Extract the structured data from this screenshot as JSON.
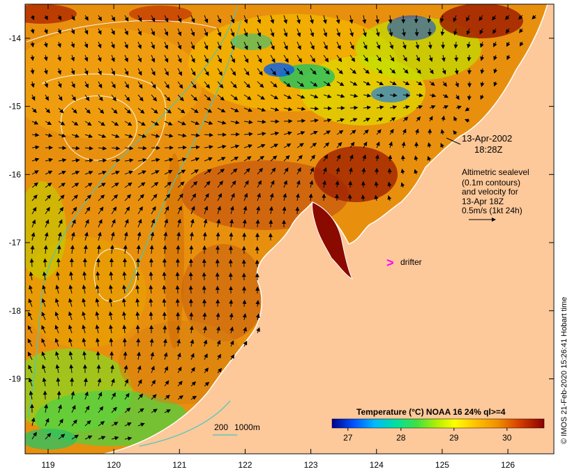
{
  "map": {
    "lon_ticks": [
      "119",
      "120",
      "121",
      "122",
      "123",
      "124",
      "125",
      "126"
    ],
    "lat_ticks": [
      "-14",
      "-15",
      "-16",
      "-17",
      "-18",
      "-19"
    ],
    "lon_range": [
      118.65,
      126.7
    ],
    "lat_range": [
      -13.5,
      -20.1
    ]
  },
  "annotations": {
    "date": "13-Apr-2002",
    "time": "18:28Z",
    "altimetry_lines": [
      "Altimetric sealevel",
      "(0.1m contours)",
      "and velocity for",
      "13-Apr 18Z",
      "0.5m/s (1kt 24h)"
    ],
    "drifter_label": "drifter",
    "drifter_color": "#ff00ff"
  },
  "isobath": {
    "label_200": "200",
    "label_1000": "1000m",
    "color": "#40c8c0"
  },
  "legend": {
    "title": "Temperature (°C) NOAA 16 24% ql>=4",
    "ticks": [
      "27",
      "28",
      "29",
      "30"
    ],
    "range": [
      26.7,
      30.7
    ],
    "colors": [
      "#00008b",
      "#0060ff",
      "#00c0ff",
      "#00e0a0",
      "#40e040",
      "#c0f000",
      "#ffff00",
      "#ffc000",
      "#f09000",
      "#e06000",
      "#c02000",
      "#8b0000"
    ]
  },
  "credit": "© IMOS 21-Feb-2020 15:26:41 Hobart time",
  "colors": {
    "land": "#fdc89a",
    "sea_warm": "#e07a10",
    "frame": "#000000"
  }
}
